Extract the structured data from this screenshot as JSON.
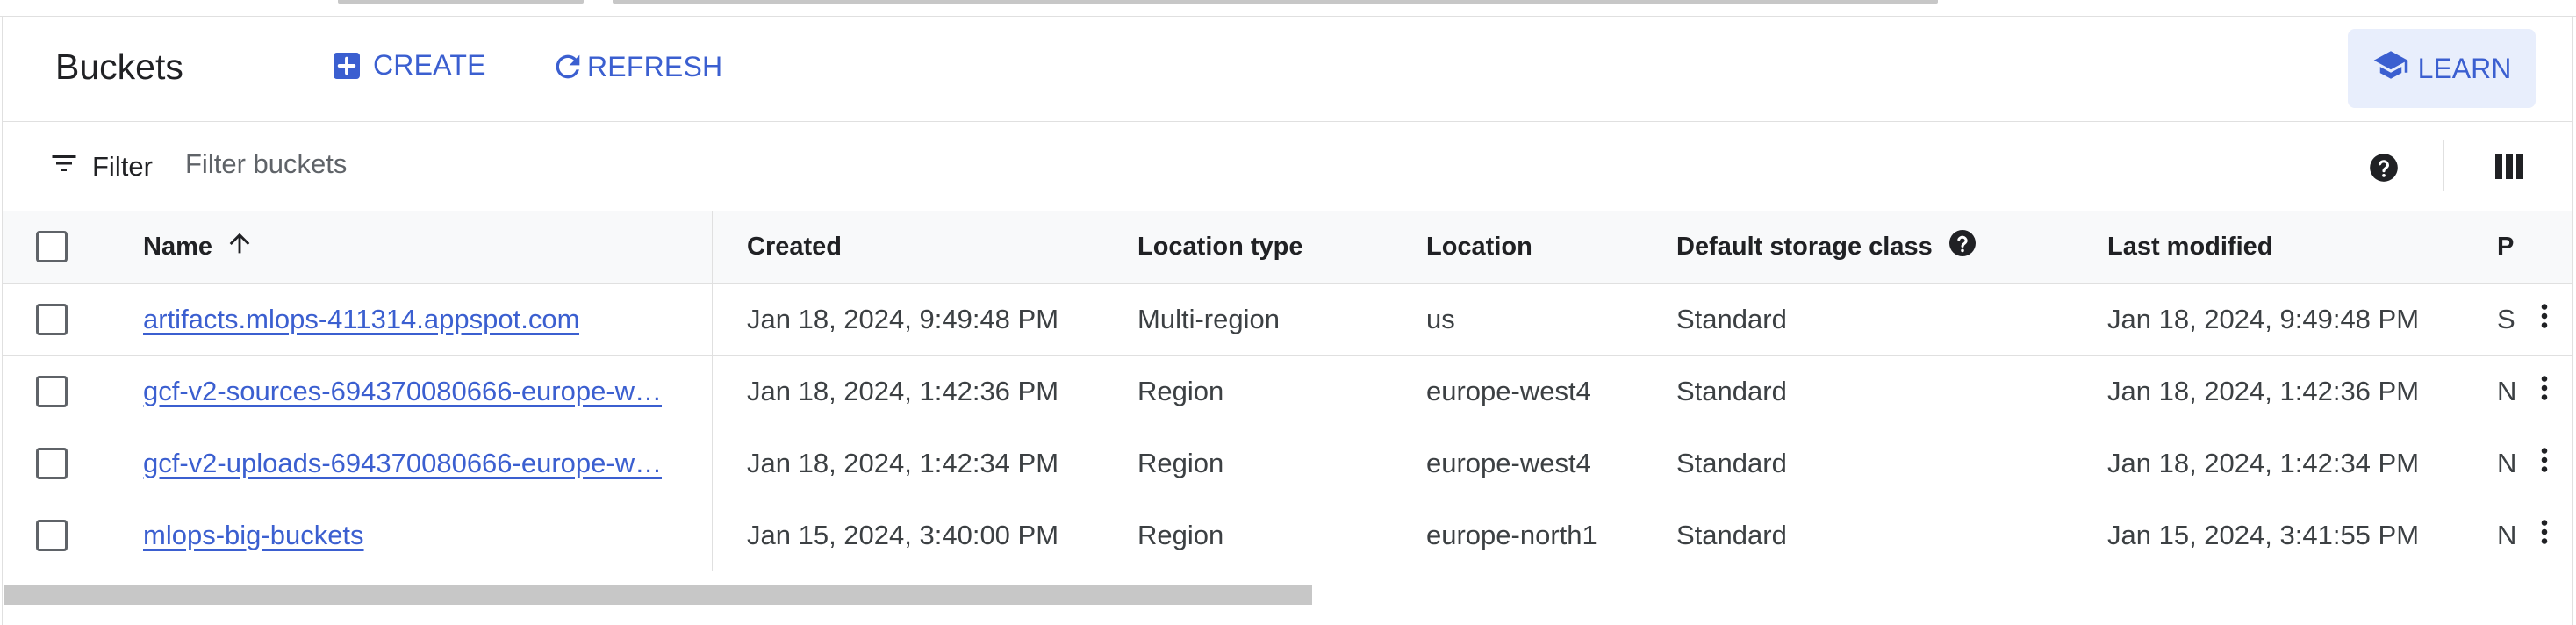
{
  "header": {
    "title": "Buckets",
    "create_label": "CREATE",
    "refresh_label": "REFRESH",
    "learn_label": "LEARN"
  },
  "filter": {
    "label": "Filter",
    "placeholder": "Filter buckets"
  },
  "table": {
    "columns": {
      "name": "Name",
      "created": "Created",
      "location_type": "Location type",
      "location": "Location",
      "storage_class": "Default storage class",
      "last_modified": "Last modified",
      "p": "P"
    },
    "rows": [
      {
        "name": "artifacts.mlops-411314.appspot.com",
        "created": "Jan 18, 2024, 9:49:48 PM",
        "location_type": "Multi-region",
        "location": "us",
        "storage_class": "Standard",
        "last_modified": "Jan 18, 2024, 9:49:48 PM",
        "p": "S"
      },
      {
        "name": "gcf-v2-sources-694370080666-europe-w…",
        "created": "Jan 18, 2024, 1:42:36 PM",
        "location_type": "Region",
        "location": "europe-west4",
        "storage_class": "Standard",
        "last_modified": "Jan 18, 2024, 1:42:36 PM",
        "p": "N"
      },
      {
        "name": "gcf-v2-uploads-694370080666-europe-w…",
        "created": "Jan 18, 2024, 1:42:34 PM",
        "location_type": "Region",
        "location": "europe-west4",
        "storage_class": "Standard",
        "last_modified": "Jan 18, 2024, 1:42:34 PM",
        "p": "N"
      },
      {
        "name": "mlops-big-buckets",
        "created": "Jan 15, 2024, 3:40:00 PM",
        "location_type": "Region",
        "location": "europe-north1",
        "storage_class": "Standard",
        "last_modified": "Jan 15, 2024, 3:41:55 PM",
        "p": "N"
      }
    ]
  },
  "icons": {
    "create": "add-box-icon",
    "refresh": "refresh-icon",
    "learn": "school-icon",
    "filter": "filter-list-icon",
    "help": "help-icon",
    "columns": "column-view-icon",
    "sort": "arrow-upward-icon",
    "row_menu": "more-vert-icon"
  },
  "colors": {
    "accent": "#3b5fd0",
    "learn_bg": "#e8eefc"
  }
}
